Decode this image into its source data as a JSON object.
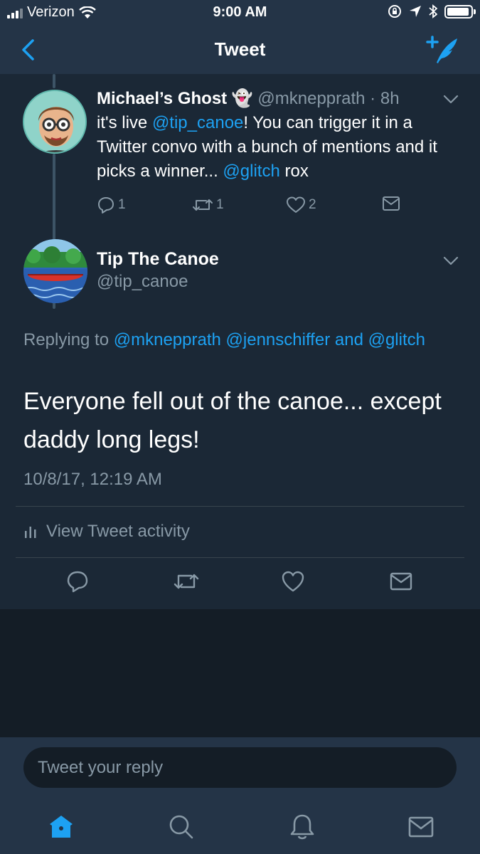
{
  "status_bar": {
    "carrier": "Verizon",
    "time": "9:00 AM",
    "icons": [
      "signal-icon",
      "wifi-icon",
      "rotation-lock-icon",
      "location-icon",
      "bluetooth-icon",
      "battery-icon"
    ],
    "battery_level": 0.95
  },
  "header": {
    "title": "Tweet",
    "back_icon": "chevron-left-icon",
    "compose_icon": "compose-tweet-icon"
  },
  "parent_tweet": {
    "name": "Michael’s Ghost",
    "emoji": "👻",
    "handle": "@mknepprath",
    "separator": "·",
    "age": "8h",
    "text_parts": {
      "t1": "it's live ",
      "mention1": "@tip_canoe",
      "t2": "! You can trigger it in a Twitter convo with a bunch of mentions and it picks a winner... ",
      "mention2": "@glitch",
      "t3": " rox"
    },
    "reply_count": "1",
    "retweet_count": "1",
    "like_count": "2"
  },
  "main_tweet": {
    "name": "Tip The Canoe",
    "handle": "@tip_canoe",
    "replying_prefix": "Replying to ",
    "replying_mentions": {
      "m1": "@mknepprath",
      "m2": "@jennschiffer",
      "and": " and ",
      "m3": "@glitch"
    },
    "text": "Everyone fell out of the canoe... except daddy long legs!",
    "timestamp": "10/8/17, 12:19 AM",
    "activity_label": "View Tweet activity"
  },
  "reply": {
    "placeholder": "Tweet your reply"
  },
  "tabs": [
    "home-icon",
    "search-icon",
    "notifications-icon",
    "messages-icon"
  ],
  "colors": {
    "accent": "#1da1f2",
    "background": "#141d26",
    "surface": "#1b2836",
    "bar": "#243447",
    "muted_text": "#8899a6"
  }
}
